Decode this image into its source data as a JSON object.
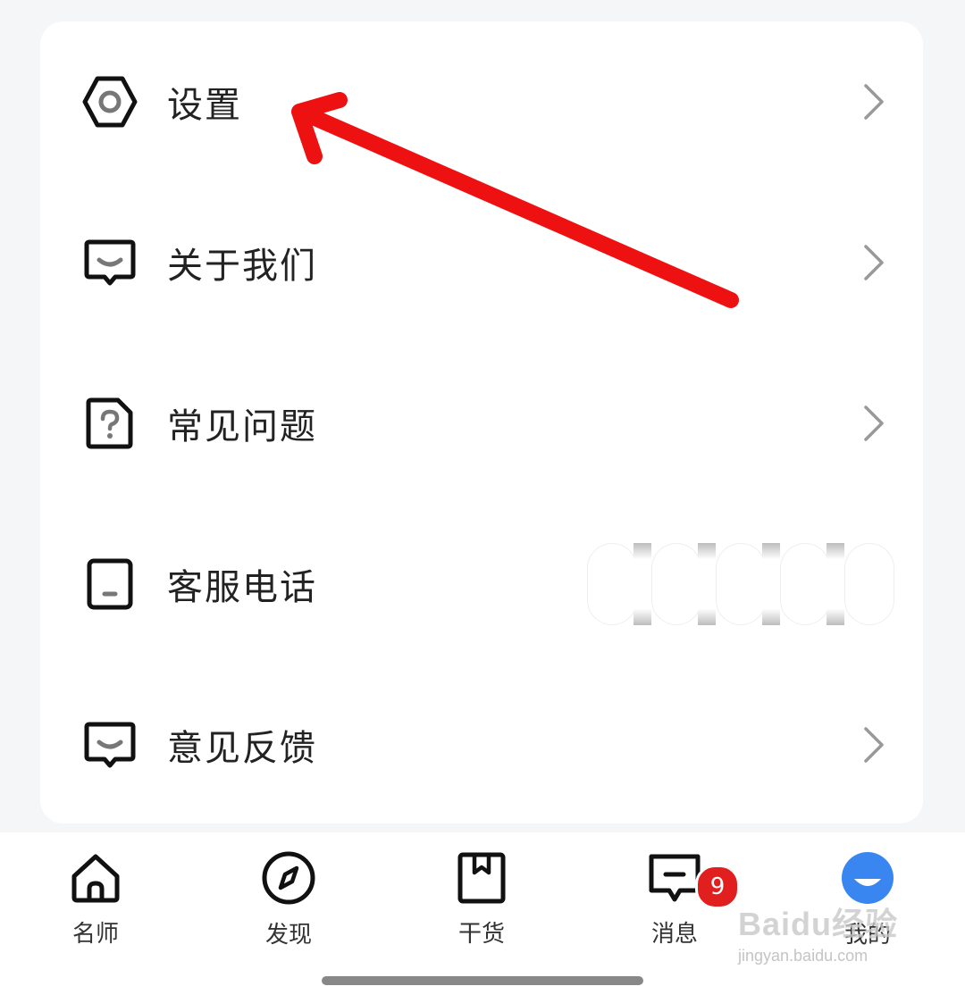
{
  "menu": {
    "items": [
      {
        "label": "设置",
        "icon": "gear-hexagon-icon",
        "has_chevron": true
      },
      {
        "label": "关于我们",
        "icon": "chat-bubble-smile-icon",
        "has_chevron": true
      },
      {
        "label": "常见问题",
        "icon": "question-document-icon",
        "has_chevron": true
      },
      {
        "label": "客服电话",
        "icon": "phone-device-icon",
        "has_chevron": false
      },
      {
        "label": "意见反馈",
        "icon": "chat-bubble-smile-icon",
        "has_chevron": true
      }
    ]
  },
  "tabbar": {
    "tabs": [
      {
        "label": "名师",
        "icon": "home-icon"
      },
      {
        "label": "发现",
        "icon": "compass-icon"
      },
      {
        "label": "干货",
        "icon": "bookmark-book-icon"
      },
      {
        "label": "消息",
        "icon": "message-icon",
        "badge": "9"
      },
      {
        "label": "我的",
        "icon": "profile-icon",
        "active": true
      }
    ]
  },
  "watermark": {
    "brand": "Baidu经验",
    "url": "jingyan.baidu.com"
  },
  "colors": {
    "accent": "#3a86f0",
    "badge": "#e11f1f",
    "annotation_arrow": "#ee1111"
  }
}
